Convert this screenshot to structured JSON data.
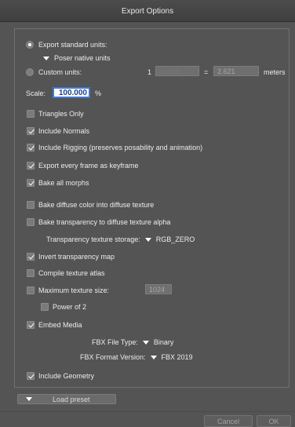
{
  "window": {
    "title": "Export Options"
  },
  "units": {
    "standard_label": "Export standard units:",
    "standard_selected": true,
    "poser_native_label": "Poser native units",
    "custom_label": "Custom units:",
    "custom_selected": false,
    "custom_count": "1",
    "custom_unit_placeholder": "myUnit",
    "equals": "=",
    "custom_value": "2.621",
    "meters_label": "meters"
  },
  "scale": {
    "label": "Scale:",
    "value": "100.000",
    "unit": "%"
  },
  "options": [
    {
      "label": "Triangles Only",
      "checked": false
    },
    {
      "label": "Include Normals",
      "checked": true
    },
    {
      "label": "Include Rigging (preserves posability and animation)",
      "checked": true
    },
    {
      "label": "Export every frame as keyframe",
      "checked": true
    },
    {
      "label": "Bake all morphs",
      "checked": true
    },
    {
      "label": "Bake diffuse color into diffuse texture",
      "checked": false
    },
    {
      "label": "Bake transparency to diffuse texture alpha",
      "checked": false
    },
    {
      "label": "Invert transparency map",
      "checked": true
    },
    {
      "label": "Compile texture atlas",
      "checked": false
    },
    {
      "label": "Maximum texture size:",
      "checked": false
    },
    {
      "label": "Power of 2",
      "checked": false
    },
    {
      "label": "Embed Media",
      "checked": true
    },
    {
      "label": "Include Geometry",
      "checked": true
    }
  ],
  "transparency_storage": {
    "label": "Transparency texture storage:",
    "value": "RGB_ZERO"
  },
  "max_texture_value": "1024",
  "fbx_file_type": {
    "label": "FBX File Type:",
    "value": "Binary"
  },
  "fbx_format_version": {
    "label": "FBX Format Version:",
    "value": "FBX 2019"
  },
  "footer": {
    "load_preset": "Load preset",
    "cancel": "Cancel",
    "ok": "OK"
  }
}
